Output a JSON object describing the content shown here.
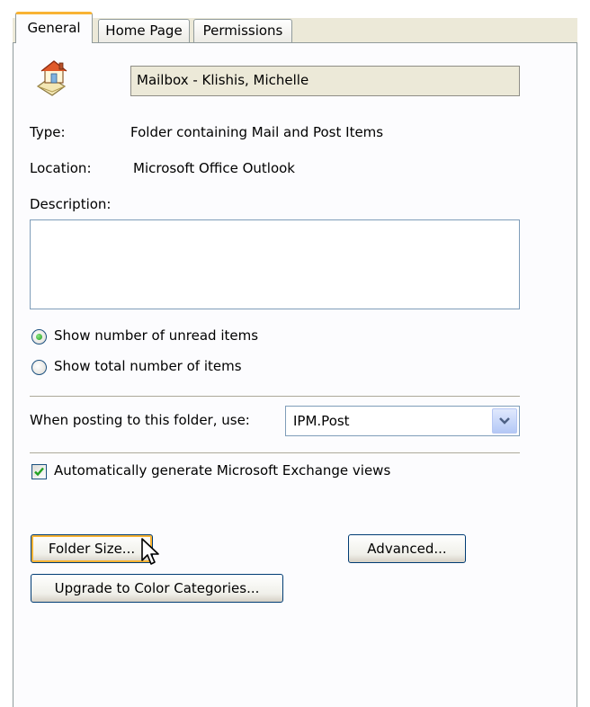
{
  "tabs": [
    {
      "label": "General",
      "active": true
    },
    {
      "label": "Home Page",
      "active": false
    },
    {
      "label": "Permissions",
      "active": false
    }
  ],
  "folder": {
    "icon": "mailbox-home-icon",
    "name": "Mailbox - Klishis, Michelle"
  },
  "type": {
    "label": "Type:",
    "value": "Folder containing Mail and Post Items"
  },
  "location": {
    "label": "Location:",
    "value": "Microsoft Office Outlook"
  },
  "description": {
    "label": "Description:",
    "value": ""
  },
  "count_options": [
    {
      "label": "Show number of unread items",
      "selected": true
    },
    {
      "label": "Show total number of items",
      "selected": false
    }
  ],
  "posting": {
    "label": "When posting to this folder, use:",
    "value": "IPM.Post"
  },
  "auto_views": {
    "label": "Automatically generate Microsoft Exchange views",
    "checked": true
  },
  "buttons": {
    "folder_size": "Folder Size...",
    "advanced": "Advanced...",
    "upgrade": "Upgrade to Color Categories..."
  },
  "colors": {
    "focus_accent": "#f8b334",
    "radio_selected": "#21a121",
    "check_mark": "#21a121"
  }
}
